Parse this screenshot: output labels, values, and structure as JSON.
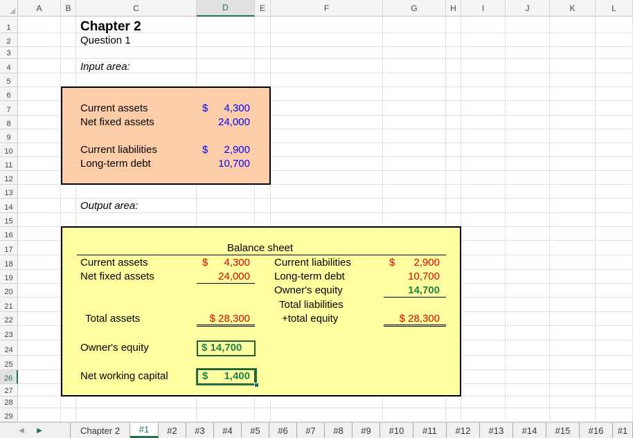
{
  "columns": [
    "A",
    "B",
    "C",
    "D",
    "E",
    "F",
    "G",
    "H",
    "I",
    "J",
    "K",
    "L"
  ],
  "rows": [
    "1",
    "2",
    "3",
    "4",
    "5",
    "6",
    "7",
    "8",
    "9",
    "10",
    "11",
    "12",
    "13",
    "14",
    "15",
    "16",
    "17",
    "18",
    "19",
    "20",
    "21",
    "22",
    "23",
    "24",
    "25",
    "26",
    "27",
    "28",
    "29"
  ],
  "heading": {
    "title": "Chapter 2",
    "subtitle": "Question 1"
  },
  "input_area": {
    "label": "Input area:",
    "items": [
      {
        "label": "Current assets",
        "currency": "$",
        "value": "4,300"
      },
      {
        "label": "Net fixed assets",
        "currency": "",
        "value": "24,000"
      },
      {
        "label": "Current liabilities",
        "currency": "$",
        "value": "2,900"
      },
      {
        "label": "Long-term debt",
        "currency": "",
        "value": "10,700"
      }
    ]
  },
  "output_area": {
    "label": "Output area:",
    "balance_title": "Balance sheet",
    "left": {
      "current_assets": {
        "label": "Current assets",
        "currency": "$",
        "value": "4,300"
      },
      "net_fixed_assets": {
        "label": "Net fixed assets",
        "value": "24,000"
      },
      "total_assets": {
        "label": "Total assets",
        "value": "$ 28,300"
      }
    },
    "right": {
      "current_liabilities": {
        "label": "Current liabilities",
        "currency": "$",
        "value": "2,900"
      },
      "long_term_debt": {
        "label": "Long-term debt",
        "value": "10,700"
      },
      "owners_equity": {
        "label": "Owner's equity",
        "value": "14,700"
      },
      "total_line1": "Total liabilities",
      "total_line2": "+total equity",
      "total_value": "$  28,300"
    },
    "owners_equity": {
      "label": "Owner's equity",
      "value": "$ 14,700"
    },
    "nwc": {
      "label": "Net working capital",
      "currency": "$",
      "value": "1,400"
    }
  },
  "selected": {
    "column": "D",
    "row": "26"
  },
  "tabs": [
    "Chapter 2",
    "#1",
    "#2",
    "#3",
    "#4",
    "#5",
    "#6",
    "#7",
    "#8",
    "#9",
    "#10",
    "#11",
    "#12",
    "#13",
    "#14",
    "#15",
    "#16",
    "#1"
  ],
  "active_tab": "#1",
  "nav": {
    "prev": "◀",
    "next": "▶"
  }
}
